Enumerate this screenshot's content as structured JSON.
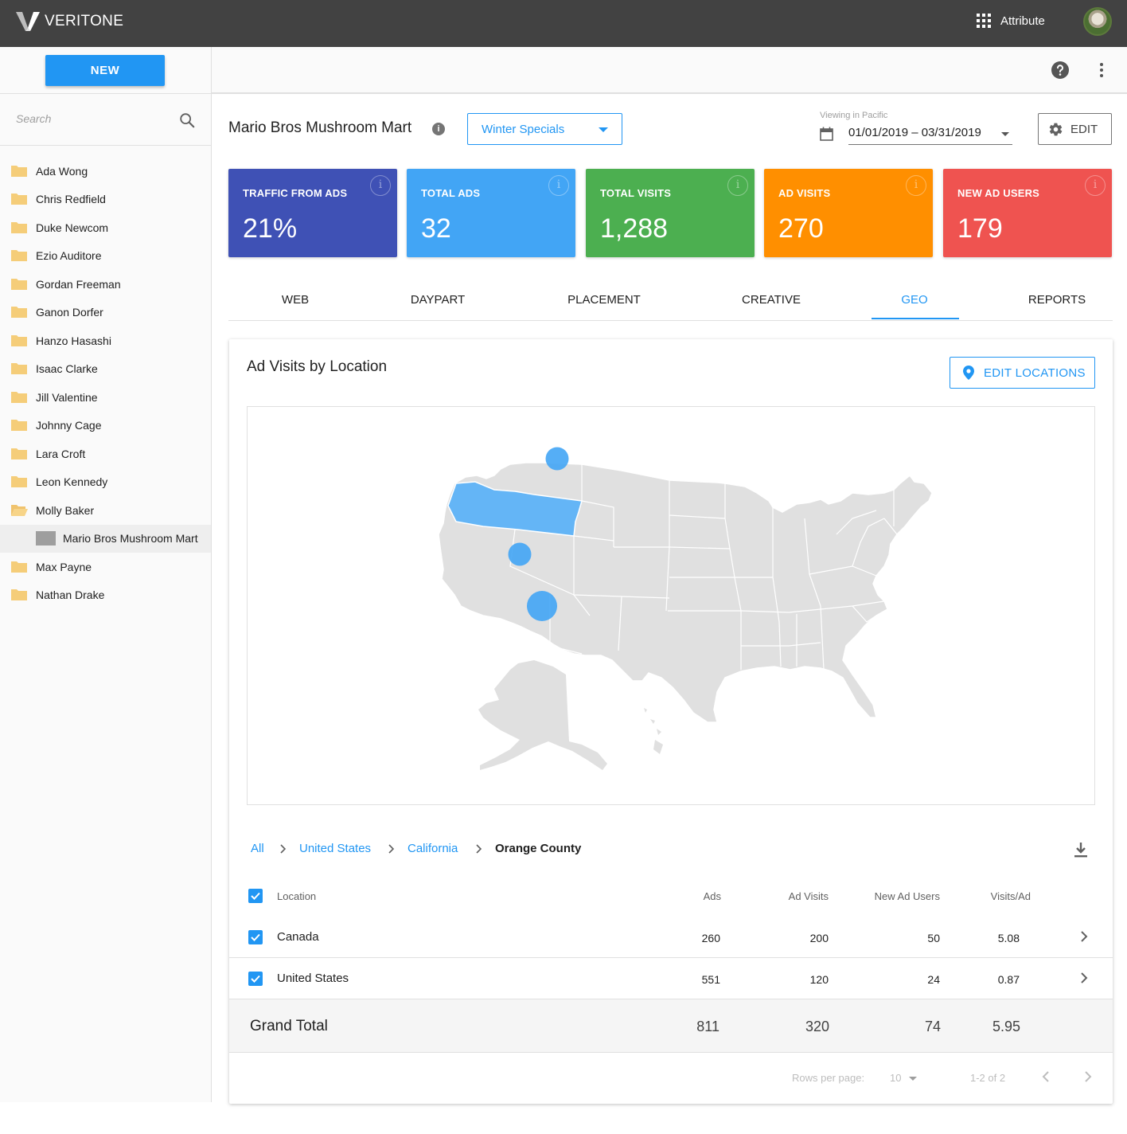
{
  "app": {
    "brand": "VERITONE",
    "apps_label": "Attribute"
  },
  "sidebar": {
    "new_label": "NEW",
    "search_placeholder": "Search",
    "items": [
      {
        "label": "Ada Wong"
      },
      {
        "label": "Chris Redfield"
      },
      {
        "label": "Duke Newcom"
      },
      {
        "label": "Ezio Auditore"
      },
      {
        "label": "Gordan Freeman"
      },
      {
        "label": "Ganon Dorfer"
      },
      {
        "label": "Hanzo Hasashi"
      },
      {
        "label": "Isaac Clarke"
      },
      {
        "label": "Jill Valentine"
      },
      {
        "label": "Johnny Cage"
      },
      {
        "label": "Lara Croft"
      },
      {
        "label": "Leon Kennedy"
      },
      {
        "label": "Molly Baker"
      },
      {
        "label": "Mario Bros Mushroom Mart"
      },
      {
        "label": "Max Payne"
      },
      {
        "label": "Nathan Drake"
      }
    ]
  },
  "header": {
    "title": "Mario Bros Mushroom Mart",
    "campaign": "Winter Specials",
    "timezone_label": "Viewing in Pacific",
    "date_range": "01/01/2019 – 03/31/2019",
    "edit_label": "EDIT"
  },
  "stats": [
    {
      "label": "TRAFFIC FROM ADS",
      "value": "21%",
      "color": "#3f51b5"
    },
    {
      "label": "TOTAL ADS",
      "value": "32",
      "color": "#42a5f5"
    },
    {
      "label": "TOTAL VISITS",
      "value": "1,288",
      "color": "#4caf50"
    },
    {
      "label": "AD VISITS",
      "value": "270",
      "color": "#ff8f00"
    },
    {
      "label": "NEW AD USERS",
      "value": "179",
      "color": "#ef5350"
    }
  ],
  "tabs": [
    {
      "label": "WEB"
    },
    {
      "label": "DAYPART"
    },
    {
      "label": "PLACEMENT"
    },
    {
      "label": "CREATIVE"
    },
    {
      "label": "GEO",
      "active": true
    },
    {
      "label": "REPORTS"
    }
  ],
  "panel": {
    "title": "Ad Visits by Location",
    "edit_locations_label": "EDIT LOCATIONS"
  },
  "breadcrumb": [
    "All",
    "United States",
    "California",
    "Orange County"
  ],
  "table": {
    "columns": [
      "Location",
      "Ads",
      "Ad Visits",
      "New Ad Users",
      "Visits/Ad"
    ],
    "rows": [
      {
        "location": "Canada",
        "ads": "260",
        "ad_visits": "200",
        "new_ad_users": "50",
        "visits_per_ad": "5.08"
      },
      {
        "location": "United States",
        "ads": "551",
        "ad_visits": "120",
        "new_ad_users": "24",
        "visits_per_ad": "0.87"
      }
    ],
    "total": {
      "label": "Grand Total",
      "ads": "811",
      "ad_visits": "320",
      "new_ad_users": "74",
      "visits_per_ad": "5.95"
    }
  },
  "pagination": {
    "rows_per_page_label": "Rows per page:",
    "rows_per_page": "10",
    "range": "1-2 of 2"
  },
  "colors": {
    "accent": "#2196f3",
    "map_land": "#e0e0e0",
    "map_highlight": "#64b5f6"
  }
}
